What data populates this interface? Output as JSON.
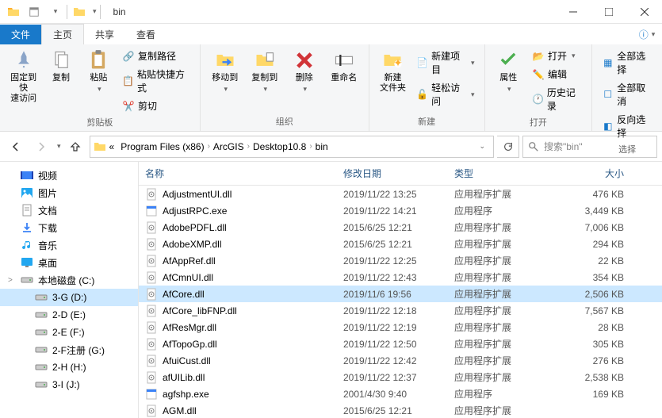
{
  "window": {
    "title": "bin"
  },
  "tabs": {
    "file": "文件",
    "home": "主页",
    "share": "共享",
    "view": "查看"
  },
  "ribbon": {
    "clipboard": {
      "label": "剪贴板",
      "pin": "固定到快\n速访问",
      "copy": "复制",
      "paste": "粘贴",
      "copy_path": "复制路径",
      "paste_shortcut": "粘贴快捷方式",
      "cut": "剪切"
    },
    "organize": {
      "label": "组织",
      "move_to": "移动到",
      "copy_to": "复制到",
      "delete": "删除",
      "rename": "重命名"
    },
    "new": {
      "label": "新建",
      "new_folder": "新建\n文件夹",
      "new_item": "新建项目",
      "easy_access": "轻松访问"
    },
    "open": {
      "label": "打开",
      "properties": "属性",
      "open": "打开",
      "edit": "编辑",
      "history": "历史记录"
    },
    "select": {
      "label": "选择",
      "select_all": "全部选择",
      "select_none": "全部取消",
      "invert": "反向选择"
    }
  },
  "breadcrumb": [
    "Program Files (x86)",
    "ArcGIS",
    "Desktop10.8",
    "bin"
  ],
  "search_placeholder": "搜索\"bin\"",
  "sidebar": {
    "items": [
      {
        "label": "视频",
        "icon": "video",
        "indent": false
      },
      {
        "label": "图片",
        "icon": "pictures",
        "indent": false
      },
      {
        "label": "文档",
        "icon": "documents",
        "indent": false
      },
      {
        "label": "下载",
        "icon": "downloads",
        "indent": false
      },
      {
        "label": "音乐",
        "icon": "music",
        "indent": false
      },
      {
        "label": "桌面",
        "icon": "desktop",
        "indent": false
      },
      {
        "label": "本地磁盘 (C:)",
        "icon": "disk",
        "indent": false,
        "exp": ">"
      },
      {
        "label": "3-G (D:)",
        "icon": "disk",
        "indent": true,
        "selected": true
      },
      {
        "label": "2-D (E:)",
        "icon": "disk",
        "indent": true
      },
      {
        "label": "2-E (F:)",
        "icon": "disk",
        "indent": true
      },
      {
        "label": "2-F注册 (G:)",
        "icon": "disk",
        "indent": true
      },
      {
        "label": "2-H (H:)",
        "icon": "disk",
        "indent": true
      },
      {
        "label": "3-I (J:)",
        "icon": "disk",
        "indent": true
      }
    ]
  },
  "columns": {
    "name": "名称",
    "date": "修改日期",
    "type": "类型",
    "size": "大小"
  },
  "files": [
    {
      "name": "AdjustmentUI.dll",
      "date": "2019/11/22 13:25",
      "type": "应用程序扩展",
      "size": "476 KB",
      "icon": "dll"
    },
    {
      "name": "AdjustRPC.exe",
      "date": "2019/11/22 14:21",
      "type": "应用程序",
      "size": "3,449 KB",
      "icon": "exe"
    },
    {
      "name": "AdobePDFL.dll",
      "date": "2015/6/25 12:21",
      "type": "应用程序扩展",
      "size": "7,006 KB",
      "icon": "dll"
    },
    {
      "name": "AdobeXMP.dll",
      "date": "2015/6/25 12:21",
      "type": "应用程序扩展",
      "size": "294 KB",
      "icon": "dll"
    },
    {
      "name": "AfAppRef.dll",
      "date": "2019/11/22 12:25",
      "type": "应用程序扩展",
      "size": "22 KB",
      "icon": "dll"
    },
    {
      "name": "AfCmnUI.dll",
      "date": "2019/11/22 12:43",
      "type": "应用程序扩展",
      "size": "354 KB",
      "icon": "dll"
    },
    {
      "name": "AfCore.dll",
      "date": "2019/11/6 19:56",
      "type": "应用程序扩展",
      "size": "2,506 KB",
      "icon": "dll",
      "selected": true
    },
    {
      "name": "AfCore_libFNP.dll",
      "date": "2019/11/22 12:18",
      "type": "应用程序扩展",
      "size": "7,567 KB",
      "icon": "dll"
    },
    {
      "name": "AfResMgr.dll",
      "date": "2019/11/22 12:19",
      "type": "应用程序扩展",
      "size": "28 KB",
      "icon": "dll"
    },
    {
      "name": "AfTopoGp.dll",
      "date": "2019/11/22 12:50",
      "type": "应用程序扩展",
      "size": "305 KB",
      "icon": "dll"
    },
    {
      "name": "AfuiCust.dll",
      "date": "2019/11/22 12:42",
      "type": "应用程序扩展",
      "size": "276 KB",
      "icon": "dll"
    },
    {
      "name": "afUILib.dll",
      "date": "2019/11/22 12:37",
      "type": "应用程序扩展",
      "size": "2,538 KB",
      "icon": "dll"
    },
    {
      "name": "agfshp.exe",
      "date": "2001/4/30 9:40",
      "type": "应用程序",
      "size": "169 KB",
      "icon": "exe"
    },
    {
      "name": "AGM.dll",
      "date": "2015/6/25 12:21",
      "type": "应用程序扩展",
      "size": "",
      "icon": "dll"
    }
  ]
}
